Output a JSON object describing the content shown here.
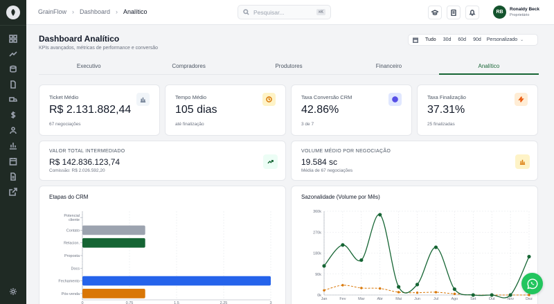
{
  "app": {
    "name": "GrainFlow"
  },
  "breadcrumb": [
    "GrainFlow",
    "Dashboard",
    "Analítico"
  ],
  "search": {
    "placeholder": "Pesquisar...",
    "shortcut": "⌘K"
  },
  "user": {
    "initials": "RB",
    "name": "Ronaldy Beck",
    "role": "Proprietário"
  },
  "page": {
    "title": "Dashboard Analítico",
    "subtitle": "KPIs avançados, métricas de performance e conversão"
  },
  "date_range": {
    "options": [
      "Tudo",
      "30d",
      "60d",
      "90d"
    ],
    "selected": "Tudo",
    "custom_label": "Personalizado"
  },
  "tabs": [
    {
      "label": "Executivo"
    },
    {
      "label": "Compradores"
    },
    {
      "label": "Produtores"
    },
    {
      "label": "Financeiro"
    },
    {
      "label": "Analítico",
      "active": true
    }
  ],
  "kpis": [
    {
      "label": "Ticket Médio",
      "value": "R$ 2.131.882,44",
      "foot": "67 negociações",
      "icon": "bar-chart-icon",
      "color": "#64748b"
    },
    {
      "label": "Tempo Médio",
      "value": "105 dias",
      "foot": "até finalização",
      "icon": "clock-icon",
      "color": "#d97706"
    },
    {
      "label": "Taxa Conversão CRM",
      "value": "42.86%",
      "foot": "3 de 7",
      "icon": "target-icon",
      "color": "#4f46e5"
    },
    {
      "label": "Taxa Finalização",
      "value": "37.31%",
      "foot": "25 finalizadas",
      "icon": "zap-icon",
      "color": "#ea580c"
    }
  ],
  "totals": [
    {
      "label": "VALOR TOTAL INTERMEDIADO",
      "value": "R$ 142.836.123,74",
      "foot": "Comissão: R$ 2.026.592,20",
      "icon": "trending-up-icon"
    },
    {
      "label": "VOLUME MÉDIO POR NEGOCIAÇÃO",
      "value": "19.584 sc",
      "foot": "Média de 67 negociações",
      "icon": "bar-chart-icon"
    }
  ],
  "chart_data": [
    {
      "type": "bar",
      "orientation": "horizontal",
      "title": "Etapas do CRM",
      "categories": [
        "Potencial cliente",
        "Contato",
        "Relacion.",
        "Proposta",
        "Docs",
        "Fechamento",
        "Pós-venda"
      ],
      "values": [
        0,
        1,
        1,
        0,
        0,
        3,
        1
      ],
      "colors": [
        "#9ca3af",
        "#9ca3af",
        "#166534",
        "#9ca3af",
        "#9ca3af",
        "#2563eb",
        "#d97706"
      ],
      "xlim": [
        0,
        3
      ],
      "xticks": [
        "0",
        "0.75",
        "1.5",
        "2.25",
        "3"
      ],
      "grid": true
    },
    {
      "type": "line",
      "title": "Sazonalidade (Volume por Mês)",
      "categories": [
        "Jan",
        "Fev",
        "Mar",
        "Abr",
        "Mai",
        "Jun",
        "Jul",
        "Ago",
        "Set",
        "Out",
        "Nov",
        "Dez"
      ],
      "ylim": [
        0,
        360000
      ],
      "yticks": [
        "0k",
        "90k",
        "180k",
        "270k",
        "360k"
      ],
      "series": [
        {
          "values": [
            125000,
            215000,
            150000,
            345000,
            35000,
            45000,
            205000,
            25000,
            0,
            0,
            0,
            165000
          ],
          "color": "#166534",
          "style": "solid"
        },
        {
          "values": [
            20000,
            42000,
            30000,
            28000,
            12000,
            10000,
            12000,
            5000,
            0,
            0,
            0,
            0
          ],
          "color": "#d97706",
          "style": "dashed"
        }
      ],
      "grid": true
    }
  ]
}
